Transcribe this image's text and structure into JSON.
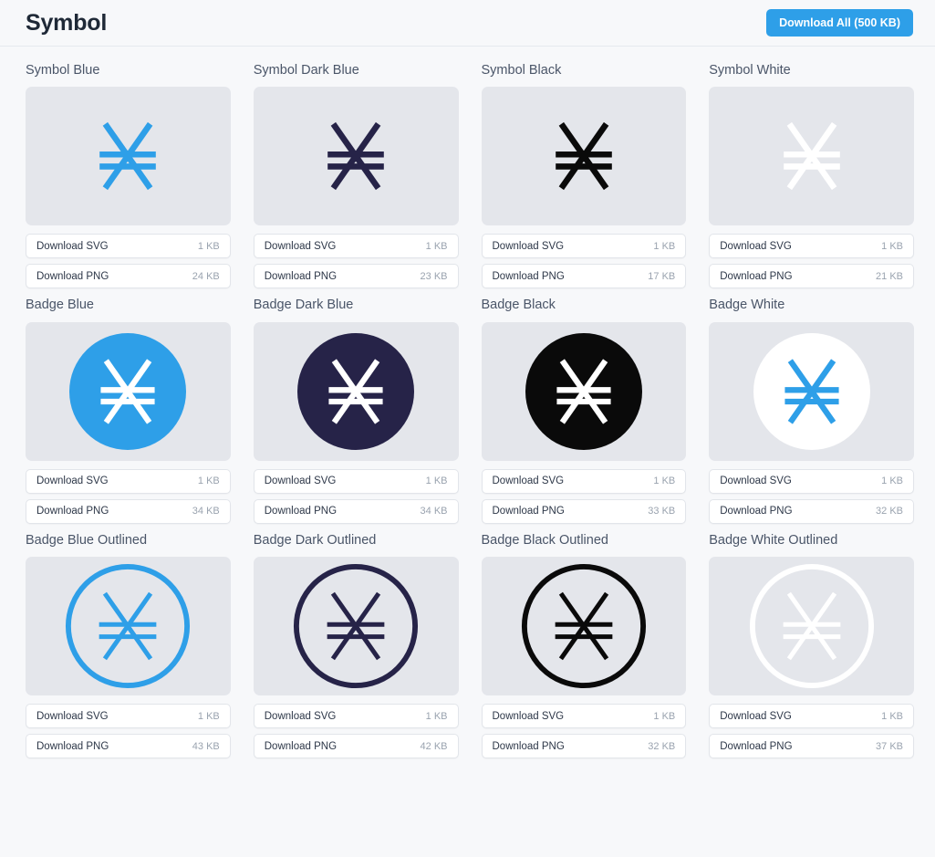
{
  "header": {
    "title": "Symbol",
    "download_all_label": "Download All (500 KB)"
  },
  "colors": {
    "brand_blue": "#2e9fe8",
    "dark_blue": "#262348",
    "black": "#0a0a0a",
    "white": "#ffffff",
    "page_background": "#f7f8fa",
    "preview_background": "#e4e6eb",
    "button_background": "#ffffff",
    "title_text": "#4a5568",
    "size_text": "#9aa3af"
  },
  "buttons": {
    "svg_label": "Download SVG",
    "png_label": "Download PNG"
  },
  "assets": [
    {
      "title": "Symbol Blue",
      "glyph": "symbol",
      "mark_color": "#2e9fe8",
      "disc_color": null,
      "ring_color": null,
      "svg_size": "1 KB",
      "png_size": "24 KB"
    },
    {
      "title": "Symbol Dark Blue",
      "glyph": "symbol",
      "mark_color": "#262348",
      "disc_color": null,
      "ring_color": null,
      "svg_size": "1 KB",
      "png_size": "23 KB"
    },
    {
      "title": "Symbol Black",
      "glyph": "symbol",
      "mark_color": "#0a0a0a",
      "disc_color": null,
      "ring_color": null,
      "svg_size": "1 KB",
      "png_size": "17 KB"
    },
    {
      "title": "Symbol White",
      "glyph": "symbol",
      "mark_color": "#ffffff",
      "disc_color": null,
      "ring_color": null,
      "svg_size": "1 KB",
      "png_size": "21 KB"
    },
    {
      "title": "Badge Blue",
      "glyph": "badge",
      "mark_color": "#ffffff",
      "disc_color": "#2e9fe8",
      "ring_color": null,
      "svg_size": "1 KB",
      "png_size": "34 KB"
    },
    {
      "title": "Badge Dark Blue",
      "glyph": "badge",
      "mark_color": "#ffffff",
      "disc_color": "#262348",
      "ring_color": null,
      "svg_size": "1 KB",
      "png_size": "34 KB"
    },
    {
      "title": "Badge Black",
      "glyph": "badge",
      "mark_color": "#ffffff",
      "disc_color": "#0a0a0a",
      "ring_color": null,
      "svg_size": "1 KB",
      "png_size": "33 KB"
    },
    {
      "title": "Badge White",
      "glyph": "badge",
      "mark_color": "#2e9fe8",
      "disc_color": "#ffffff",
      "ring_color": null,
      "svg_size": "1 KB",
      "png_size": "32 KB"
    },
    {
      "title": "Badge Blue Outlined",
      "glyph": "badge-outlined",
      "mark_color": "#2e9fe8",
      "disc_color": null,
      "ring_color": "#2e9fe8",
      "svg_size": "1 KB",
      "png_size": "43 KB"
    },
    {
      "title": "Badge Dark Outlined",
      "glyph": "badge-outlined",
      "mark_color": "#262348",
      "disc_color": null,
      "ring_color": "#262348",
      "svg_size": "1 KB",
      "png_size": "42 KB"
    },
    {
      "title": "Badge Black Outlined",
      "glyph": "badge-outlined",
      "mark_color": "#0a0a0a",
      "disc_color": null,
      "ring_color": "#0a0a0a",
      "svg_size": "1 KB",
      "png_size": "32 KB"
    },
    {
      "title": "Badge White Outlined",
      "glyph": "badge-outlined",
      "mark_color": "#ffffff",
      "disc_color": null,
      "ring_color": "#ffffff",
      "svg_size": "1 KB",
      "png_size": "37 KB"
    }
  ]
}
